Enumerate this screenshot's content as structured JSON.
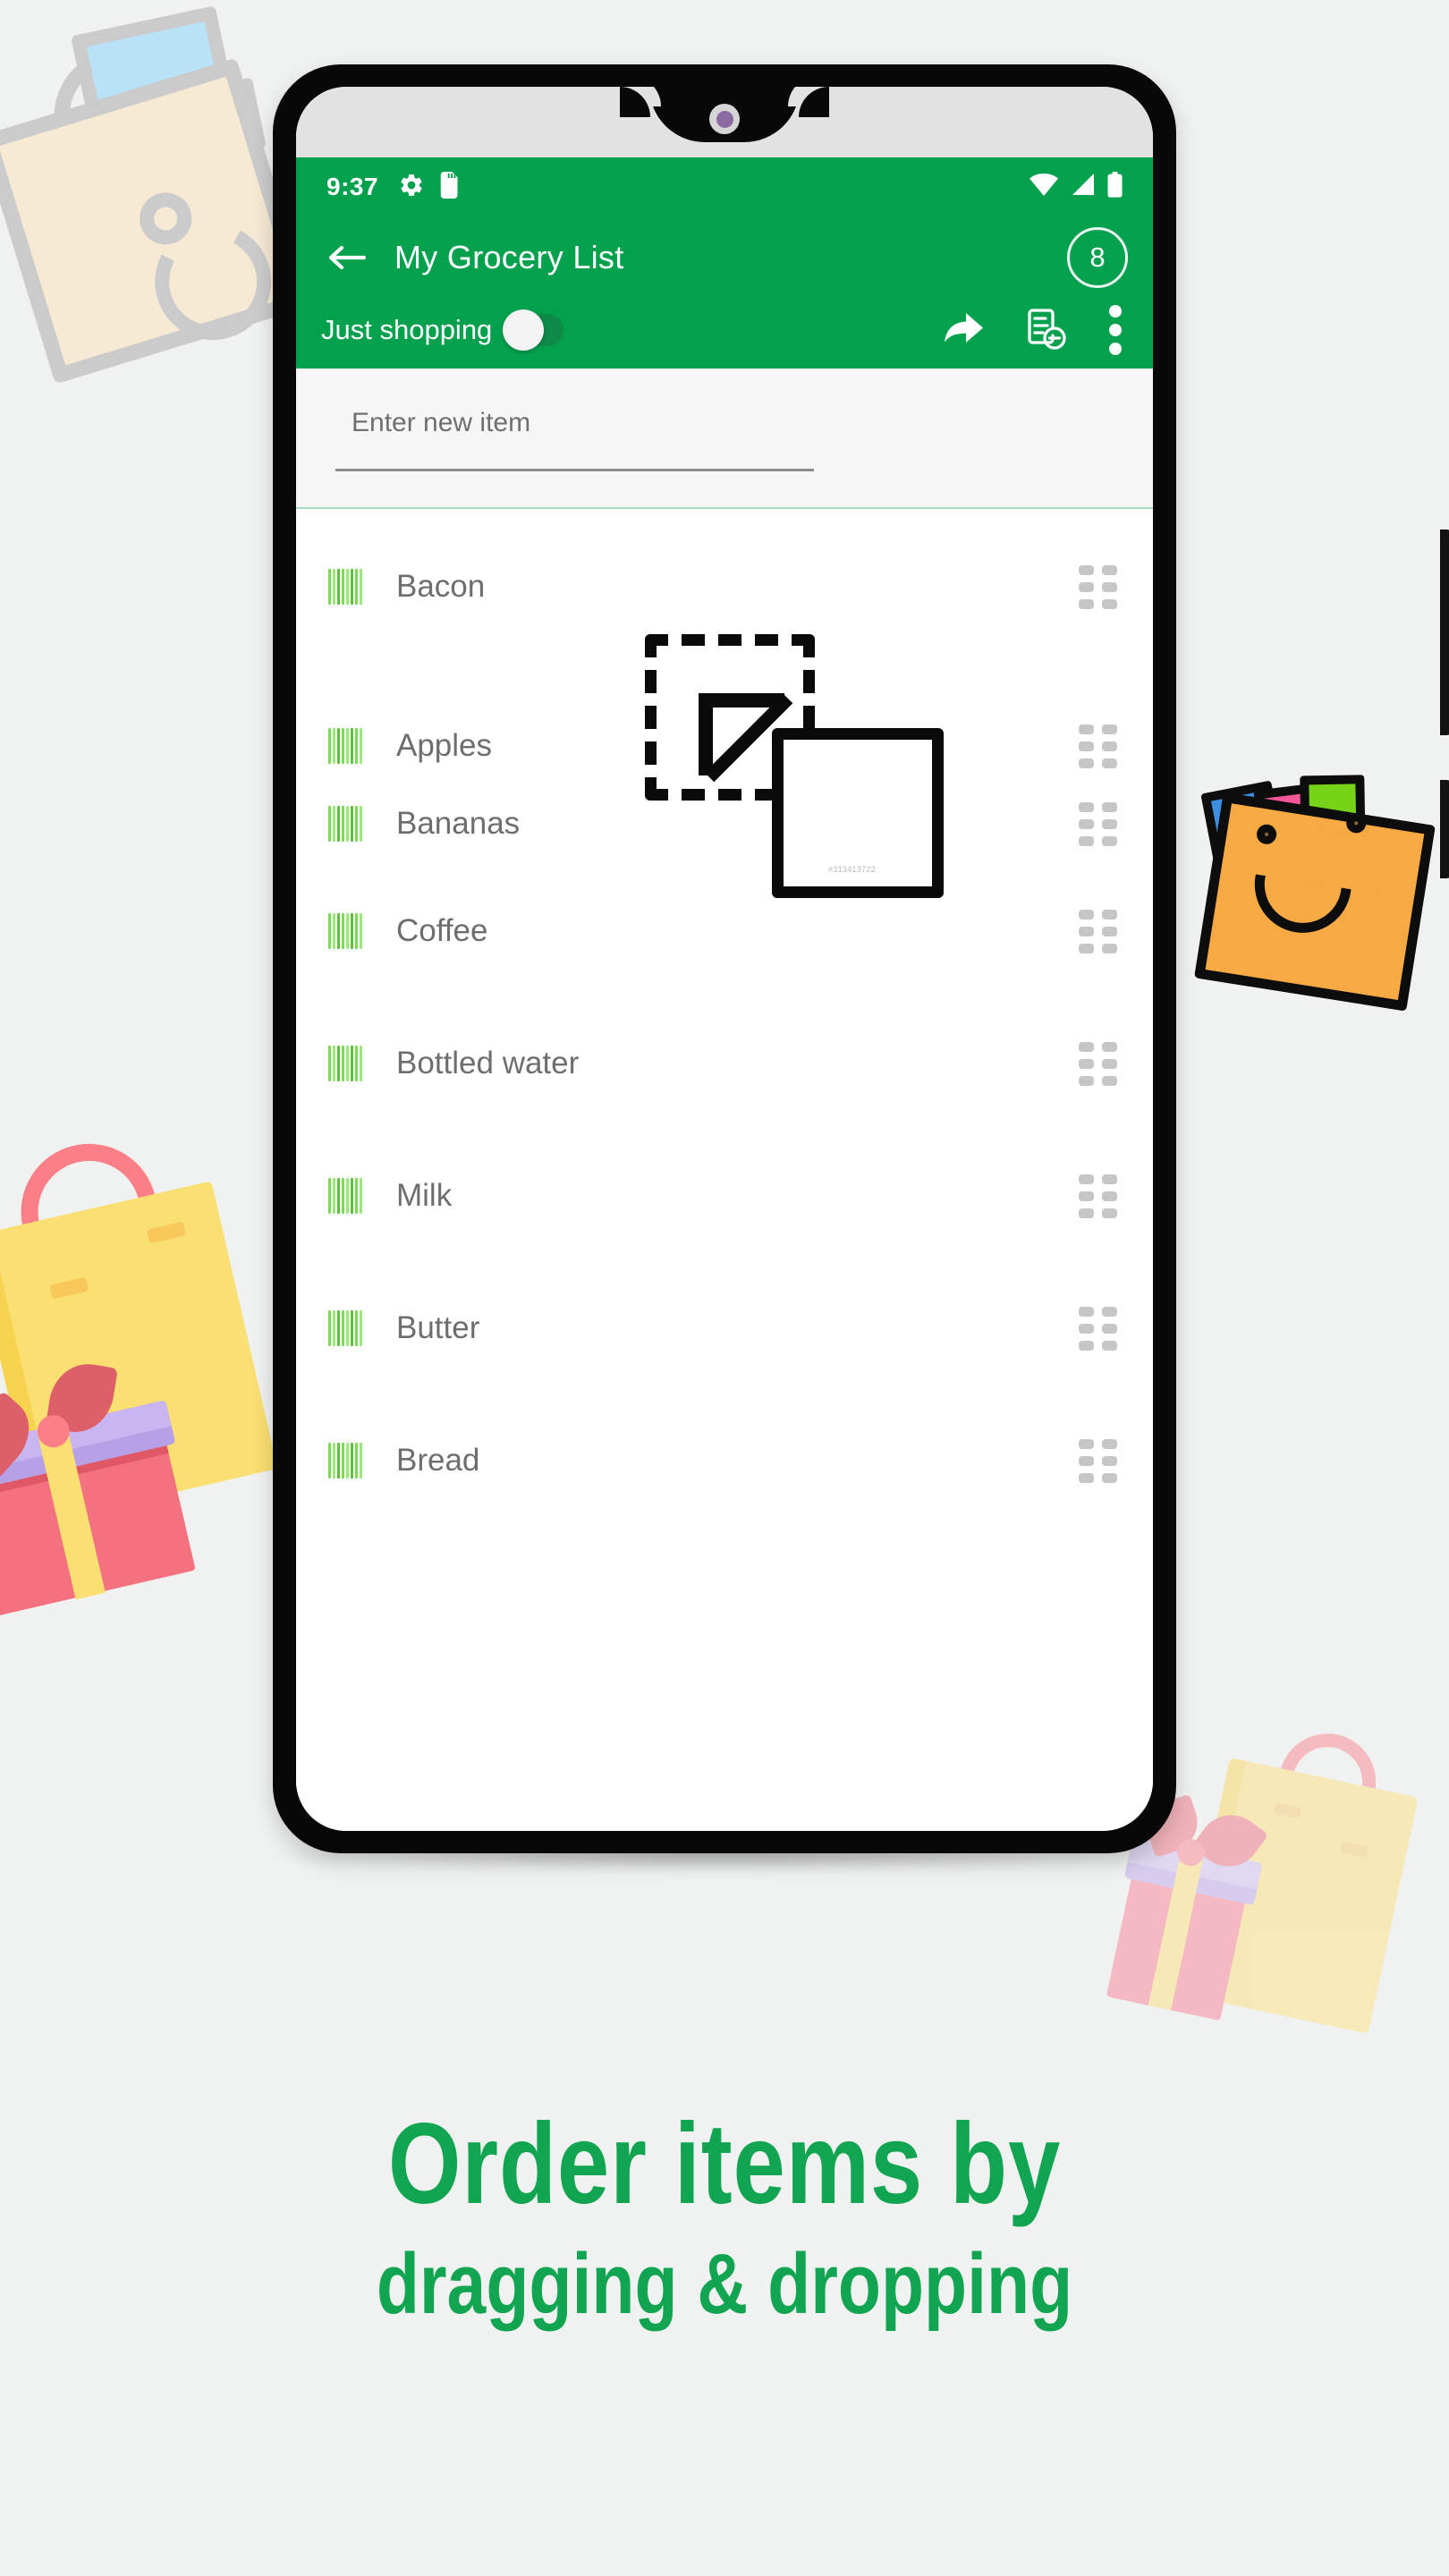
{
  "colors": {
    "app_green": "#03a14e",
    "caption_green": "#12a551",
    "page_background": "#f0f2f1",
    "barcode_green": "#7ed957",
    "drag_handle_gray": "#c6c6c6",
    "orange_bag": "#f7a944",
    "gift_bag_yellow": "#fadf72"
  },
  "status_bar": {
    "time": "9:37",
    "icons_left": [
      "gear-icon",
      "sd-card-icon"
    ],
    "icons_right": [
      "wifi-icon",
      "cellular-signal-icon",
      "battery-icon"
    ]
  },
  "app_bar": {
    "back_icon": "arrow-back-icon",
    "title": "My Grocery List",
    "item_count_badge": "8",
    "toggle_label": "Just shopping",
    "toggle_state": "off",
    "actions": [
      {
        "name": "share-icon",
        "label": "Share"
      },
      {
        "name": "remove-checked-items-icon",
        "label": "Remove checked items"
      },
      {
        "name": "overflow-menu-icon",
        "label": "More options"
      }
    ]
  },
  "new_item": {
    "placeholder": "Enter new item",
    "value": ""
  },
  "list": {
    "items": [
      {
        "label": "Bacon",
        "icon": "barcode-icon",
        "handle": "drag-handle-icon"
      },
      {
        "label": "Apples",
        "icon": "barcode-icon",
        "handle": "drag-handle-icon"
      },
      {
        "label": "Bananas",
        "icon": "barcode-icon",
        "handle": "drag-handle-icon"
      },
      {
        "label": "Coffee",
        "icon": "barcode-icon",
        "handle": "drag-handle-icon"
      },
      {
        "label": "Bottled water",
        "icon": "barcode-icon",
        "handle": "drag-handle-icon"
      },
      {
        "label": "Milk",
        "icon": "barcode-icon",
        "handle": "drag-handle-icon"
      },
      {
        "label": "Butter",
        "icon": "barcode-icon",
        "handle": "drag-handle-icon"
      },
      {
        "label": "Bread",
        "icon": "barcode-icon",
        "handle": "drag-handle-icon"
      }
    ]
  },
  "illustration": {
    "name": "drag-and-drop-icon",
    "watermark": "#313413722"
  },
  "caption": {
    "line1": "Order items by",
    "line2": "dragging & dropping"
  },
  "decorations": [
    {
      "name": "beige-shopping-bag-graphic"
    },
    {
      "name": "orange-shopping-bag-graphic"
    },
    {
      "name": "yellow-gift-bag-graphic-left"
    },
    {
      "name": "yellow-gift-bag-graphic-right"
    }
  ]
}
